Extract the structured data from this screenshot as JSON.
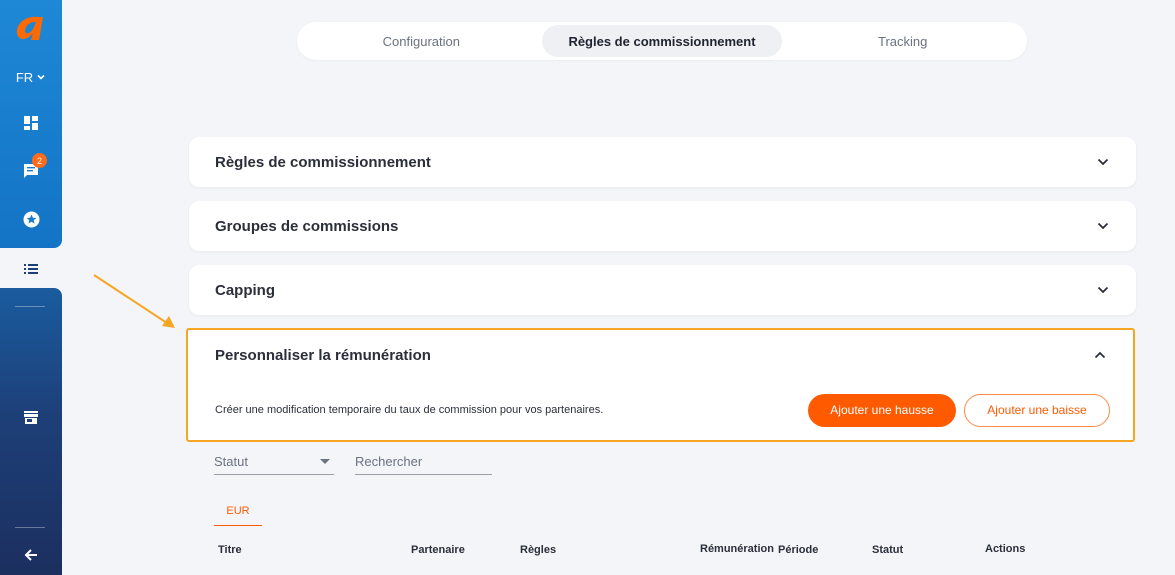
{
  "sidebar": {
    "logo_icon": "logo-a-icon",
    "language": "FR",
    "notification_count": "2",
    "items": [
      {
        "icon": "dashboard-icon"
      },
      {
        "icon": "chat-icon"
      },
      {
        "icon": "star-icon"
      },
      {
        "icon": "list-icon"
      },
      {
        "icon": "store-icon"
      },
      {
        "icon": "arrow-left-icon"
      }
    ]
  },
  "tabs": [
    {
      "label": "Configuration"
    },
    {
      "label": "Règles de commissionnement"
    },
    {
      "label": "Tracking"
    }
  ],
  "panels": {
    "rules": {
      "title": "Règles de commissionnement"
    },
    "groups": {
      "title": "Groupes de commissions"
    },
    "capping": {
      "title": "Capping"
    },
    "custom": {
      "title": "Personnaliser la rémunération",
      "description": "Créer une modification temporaire du taux de commission pour vos partenaires.",
      "increase_label": "Ajouter une hausse",
      "decrease_label": "Ajouter une baisse"
    }
  },
  "filters": {
    "status_placeholder": "Statut",
    "search_placeholder": "Rechercher"
  },
  "currency_tab": "EUR",
  "table_headers": [
    "Titre",
    "Partenaire",
    "Règles",
    "Rémunération",
    "Période",
    "Statut",
    "Actions"
  ],
  "colors": {
    "accent": "#ff5a00",
    "highlight": "#f5a623",
    "sidebar_blue": "#1e88d6"
  }
}
